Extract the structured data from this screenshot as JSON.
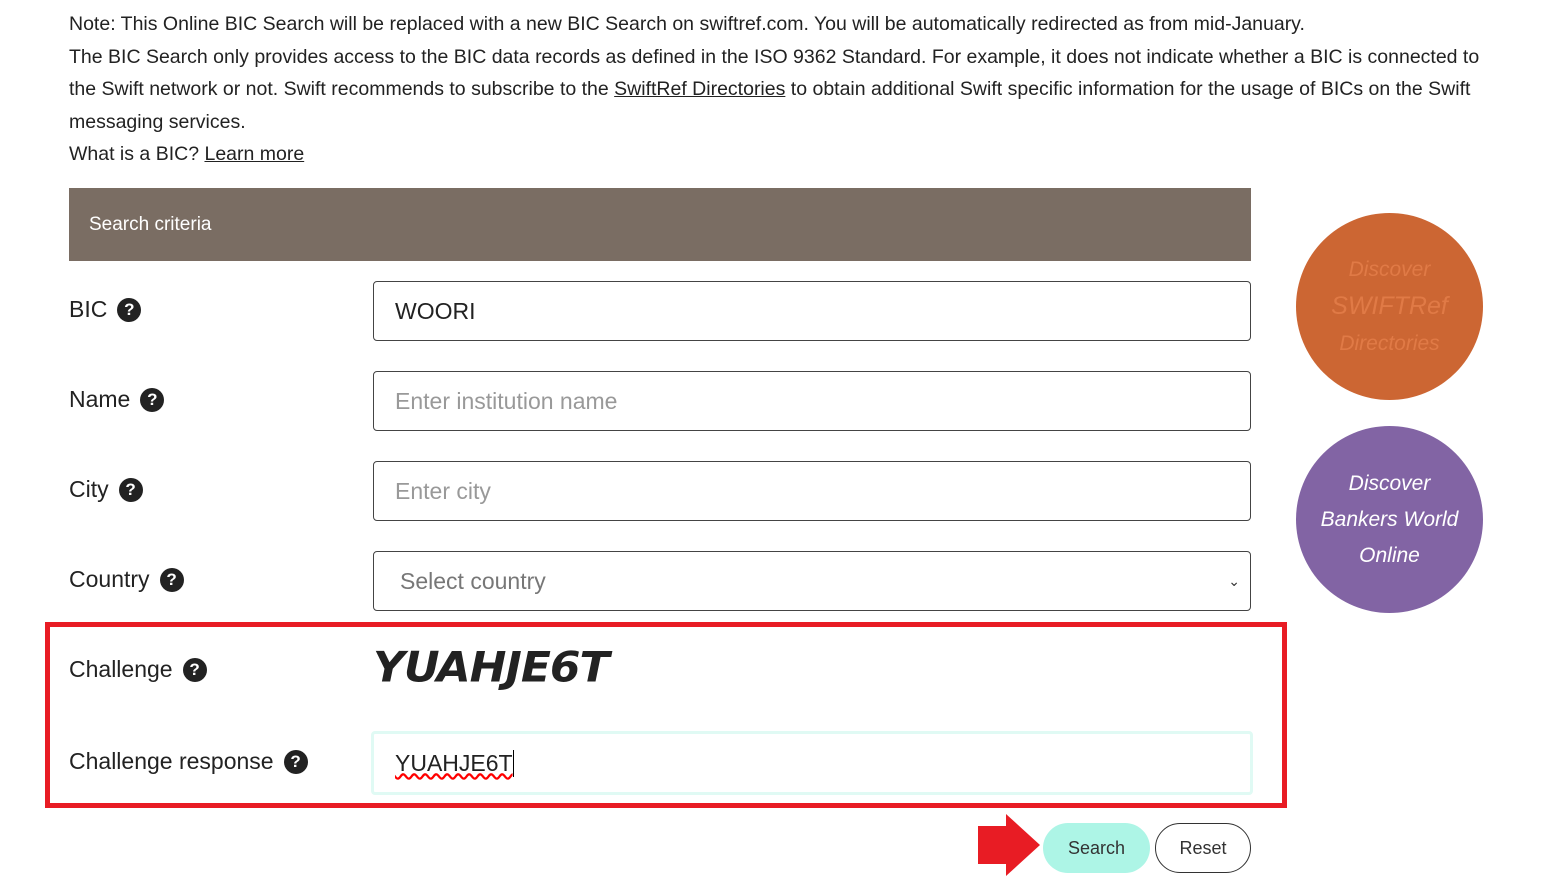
{
  "note": {
    "line1": "Note: This Online BIC Search will be replaced with a new BIC Search on swiftref.com. You will be automatically redirected as from mid-January.",
    "line2a": "The BIC Search only provides access to the BIC data records as defined in the ISO 9362 Standard. For example, it does not indicate whether a BIC is connected to the Swift network or not. Swift recommends to subscribe to the ",
    "line2_link": "SwiftRef Directories",
    "line2b": " to obtain additional Swift specific information for the usage of BICs on the Swift messaging services.",
    "line3": "What is a BIC? ",
    "line3_link": "Learn more"
  },
  "form": {
    "header": "Search criteria",
    "bic_label": "BIC",
    "bic_value": "WOORI",
    "name_label": "Name",
    "name_placeholder": "Enter institution name",
    "city_label": "City",
    "city_placeholder": "Enter city",
    "country_label": "Country",
    "country_selected": "Select country",
    "challenge_label": "Challenge",
    "challenge_image_text": "YUAHJE6T",
    "response_label": "Challenge response",
    "response_value": "YUAHJE6T",
    "search": "Search",
    "reset": "Reset"
  },
  "promo": {
    "swiftref": [
      "Discover",
      "SWIFTRef",
      "Directories"
    ],
    "bankers": [
      "Discover",
      "Bankers World",
      "Online"
    ]
  },
  "colors": {
    "header": "#7a6d63",
    "swiftref": "#cc6633",
    "bankers": "#8264a4",
    "search_btn": "#adf5e6",
    "highlight": "#e81c24"
  }
}
